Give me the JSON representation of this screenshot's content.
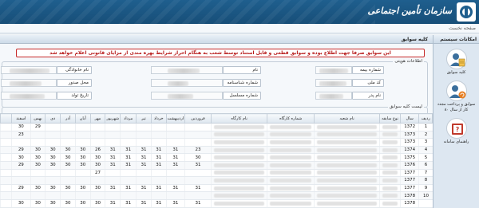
{
  "header": {
    "org_name": "سازمان تأمین اجتماعی"
  },
  "breadcrumb": "صفحه نخست",
  "side_panel": {
    "title": "امکانات سیستم",
    "items": [
      {
        "label": "کلیه سوابق",
        "icon": "person-list-icon"
      },
      {
        "label": "سوابق و پرداخت مجدد کار از سال ۸۰",
        "icon": "person-refresh-icon"
      },
      {
        "label": "راهنمای سامانه",
        "icon": "help-book-icon"
      }
    ]
  },
  "main": {
    "title": "کلیه سوابق",
    "notice": "این سوابق صرفا جهت اطلاع بوده و سوابق قطعی و قابل استناد توسط شعب به هنگام احراز شرایط بهره مندی از مزایای قانونی اعلام خواهد شد"
  },
  "identity": {
    "legend": "اطلاعات هویتی",
    "fields": {
      "insurance_number": "شماره بیمه",
      "national_code": "کد ملی",
      "father_name": "نام پدر",
      "first_name": "نام",
      "id_number": "شماره شناسنامه",
      "serial_number": "شماره مسلسل",
      "last_name": "نام خانوادگی",
      "place_of_issue": "محل صدور",
      "birth_date": "تاریخ تولد"
    }
  },
  "history": {
    "legend": "لیست کلیه سوابق",
    "columns": [
      "ردیف",
      "سال",
      "نوع سابقه",
      "نام شعبه",
      "شماره کارگاه",
      "نام کارگاه",
      "فروردین",
      "اردیبهشت",
      "خرداد",
      "تیر",
      "مرداد",
      "شهریور",
      "مهر",
      "آبان",
      "آذر",
      "دی",
      "بهمن",
      "اسفند"
    ],
    "rows": [
      {
        "row": "1",
        "year": "1372",
        "months": [
          "",
          "",
          "",
          "",
          "",
          "",
          "",
          "",
          "",
          "",
          "29",
          "30"
        ]
      },
      {
        "row": "2",
        "year": "1373",
        "months": [
          "",
          "",
          "",
          "",
          "",
          "",
          "",
          "",
          "",
          "",
          "",
          "23"
        ]
      },
      {
        "row": "3",
        "year": "1373",
        "months": [
          "",
          "",
          "",
          "",
          "",
          "",
          "",
          "",
          "",
          "",
          "",
          ""
        ]
      },
      {
        "row": "4",
        "year": "1374",
        "months": [
          "23",
          "31",
          "31",
          "31",
          "31",
          "31",
          "26",
          "30",
          "30",
          "30",
          "30",
          "29"
        ]
      },
      {
        "row": "5",
        "year": "1375",
        "months": [
          "30",
          "31",
          "31",
          "31",
          "31",
          "31",
          "30",
          "30",
          "30",
          "30",
          "30",
          "30"
        ]
      },
      {
        "row": "6",
        "year": "1376",
        "months": [
          "31",
          "31",
          "31",
          "31",
          "31",
          "31",
          "30",
          "30",
          "30",
          "30",
          "30",
          "29"
        ]
      },
      {
        "row": "7",
        "year": "1377",
        "months": [
          "",
          "",
          "",
          "",
          "",
          "",
          "27",
          "",
          "",
          "",
          "",
          ""
        ]
      },
      {
        "row": "8",
        "year": "1377",
        "months": [
          "",
          "",
          "",
          "",
          "",
          "",
          "",
          "",
          "",
          "",
          "",
          ""
        ]
      },
      {
        "row": "9",
        "year": "1377",
        "months": [
          "31",
          "31",
          "31",
          "31",
          "31",
          "31",
          "30",
          "30",
          "30",
          "30",
          "30",
          "29"
        ]
      },
      {
        "row": "10",
        "year": "1378",
        "months": [
          "",
          "",
          "",
          "",
          "",
          "",
          "",
          "",
          "",
          "",
          "",
          ""
        ]
      },
      {
        "row": "",
        "year": "1378",
        "months": [
          "31",
          "31",
          "31",
          "31",
          "31",
          "31",
          "30",
          "30",
          "30",
          "30",
          "30",
          "30"
        ]
      }
    ]
  }
}
